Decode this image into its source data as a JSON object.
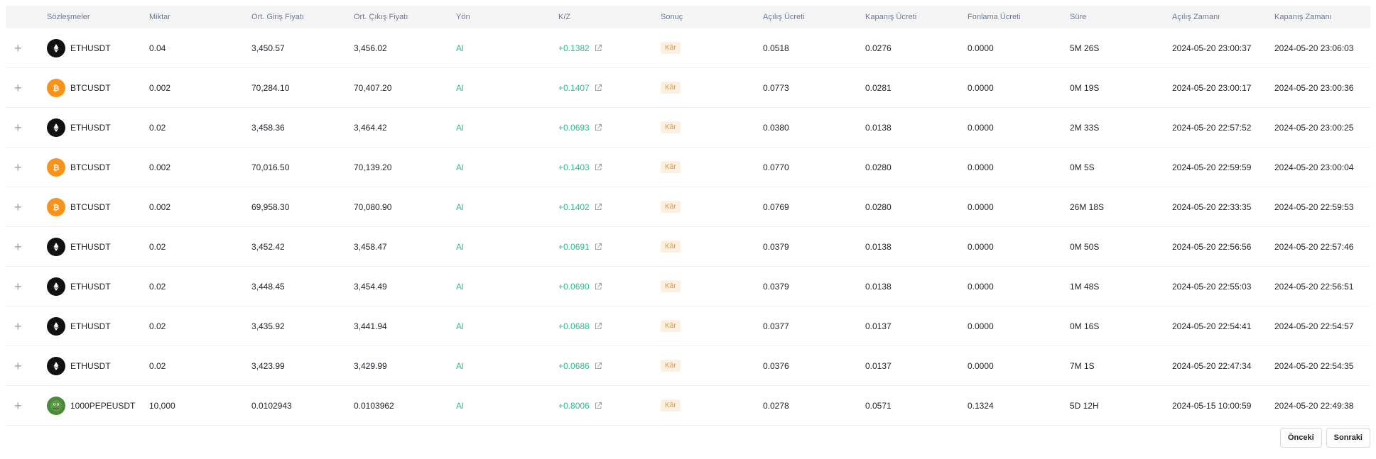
{
  "headers": {
    "contracts": "Sözleşmeler",
    "quantity": "Miktar",
    "avg_entry": "Ort. Giriş Fiyatı",
    "avg_exit": "Ort. Çıkış Fiyatı",
    "direction": "Yön",
    "pnl": "K/Z",
    "result": "Sonuç",
    "open_fee": "Açılış Ücreti",
    "close_fee": "Kapanış Ücreti",
    "funding_fee": "Fonlama Ücreti",
    "duration": "Süre",
    "open_time": "Açılış Zamanı",
    "close_time": "Kapanış Zamanı"
  },
  "rows": [
    {
      "symbol": "ETHUSDT",
      "coin": "eth",
      "qty": "0.04",
      "entry": "3,450.57",
      "exit": "3,456.02",
      "dir": "Al",
      "pnl": "+0.1382",
      "result": "Kâr",
      "open_fee": "0.0518",
      "close_fee": "0.0276",
      "funding": "0.0000",
      "duration": "5M 26S",
      "open_time": "2024-05-20 23:00:37",
      "close_time": "2024-05-20 23:06:03"
    },
    {
      "symbol": "BTCUSDT",
      "coin": "btc",
      "qty": "0.002",
      "entry": "70,284.10",
      "exit": "70,407.20",
      "dir": "Al",
      "pnl": "+0.1407",
      "result": "Kâr",
      "open_fee": "0.0773",
      "close_fee": "0.0281",
      "funding": "0.0000",
      "duration": "0M 19S",
      "open_time": "2024-05-20 23:00:17",
      "close_time": "2024-05-20 23:00:36"
    },
    {
      "symbol": "ETHUSDT",
      "coin": "eth",
      "qty": "0.02",
      "entry": "3,458.36",
      "exit": "3,464.42",
      "dir": "Al",
      "pnl": "+0.0693",
      "result": "Kâr",
      "open_fee": "0.0380",
      "close_fee": "0.0138",
      "funding": "0.0000",
      "duration": "2M 33S",
      "open_time": "2024-05-20 22:57:52",
      "close_time": "2024-05-20 23:00:25"
    },
    {
      "symbol": "BTCUSDT",
      "coin": "btc",
      "qty": "0.002",
      "entry": "70,016.50",
      "exit": "70,139.20",
      "dir": "Al",
      "pnl": "+0.1403",
      "result": "Kâr",
      "open_fee": "0.0770",
      "close_fee": "0.0280",
      "funding": "0.0000",
      "duration": "0M 5S",
      "open_time": "2024-05-20 22:59:59",
      "close_time": "2024-05-20 23:00:04"
    },
    {
      "symbol": "BTCUSDT",
      "coin": "btc",
      "qty": "0.002",
      "entry": "69,958.30",
      "exit": "70,080.90",
      "dir": "Al",
      "pnl": "+0.1402",
      "result": "Kâr",
      "open_fee": "0.0769",
      "close_fee": "0.0280",
      "funding": "0.0000",
      "duration": "26M 18S",
      "open_time": "2024-05-20 22:33:35",
      "close_time": "2024-05-20 22:59:53"
    },
    {
      "symbol": "ETHUSDT",
      "coin": "eth",
      "qty": "0.02",
      "entry": "3,452.42",
      "exit": "3,458.47",
      "dir": "Al",
      "pnl": "+0.0691",
      "result": "Kâr",
      "open_fee": "0.0379",
      "close_fee": "0.0138",
      "funding": "0.0000",
      "duration": "0M 50S",
      "open_time": "2024-05-20 22:56:56",
      "close_time": "2024-05-20 22:57:46"
    },
    {
      "symbol": "ETHUSDT",
      "coin": "eth",
      "qty": "0.02",
      "entry": "3,448.45",
      "exit": "3,454.49",
      "dir": "Al",
      "pnl": "+0.0690",
      "result": "Kâr",
      "open_fee": "0.0379",
      "close_fee": "0.0138",
      "funding": "0.0000",
      "duration": "1M 48S",
      "open_time": "2024-05-20 22:55:03",
      "close_time": "2024-05-20 22:56:51"
    },
    {
      "symbol": "ETHUSDT",
      "coin": "eth",
      "qty": "0.02",
      "entry": "3,435.92",
      "exit": "3,441.94",
      "dir": "Al",
      "pnl": "+0.0688",
      "result": "Kâr",
      "open_fee": "0.0377",
      "close_fee": "0.0137",
      "funding": "0.0000",
      "duration": "0M 16S",
      "open_time": "2024-05-20 22:54:41",
      "close_time": "2024-05-20 22:54:57"
    },
    {
      "symbol": "ETHUSDT",
      "coin": "eth",
      "qty": "0.02",
      "entry": "3,423.99",
      "exit": "3,429.99",
      "dir": "Al",
      "pnl": "+0.0686",
      "result": "Kâr",
      "open_fee": "0.0376",
      "close_fee": "0.0137",
      "funding": "0.0000",
      "duration": "7M 1S",
      "open_time": "2024-05-20 22:47:34",
      "close_time": "2024-05-20 22:54:35"
    },
    {
      "symbol": "1000PEPEUSDT",
      "coin": "pepe",
      "qty": "10,000",
      "entry": "0.0102943",
      "exit": "0.0103962",
      "dir": "Al",
      "pnl": "+0.8006",
      "result": "Kâr",
      "open_fee": "0.0278",
      "close_fee": "0.0571",
      "funding": "0.1324",
      "duration": "5D 12H",
      "open_time": "2024-05-15 10:00:59",
      "close_time": "2024-05-20 22:49:38"
    }
  ],
  "pagination": {
    "prev_label": "Önceki",
    "next_label": "Sonraki"
  },
  "colors": {
    "profit_green": "#2ebd85",
    "badge_text": "#f0962a",
    "badge_bg": "#fdf0e0"
  }
}
